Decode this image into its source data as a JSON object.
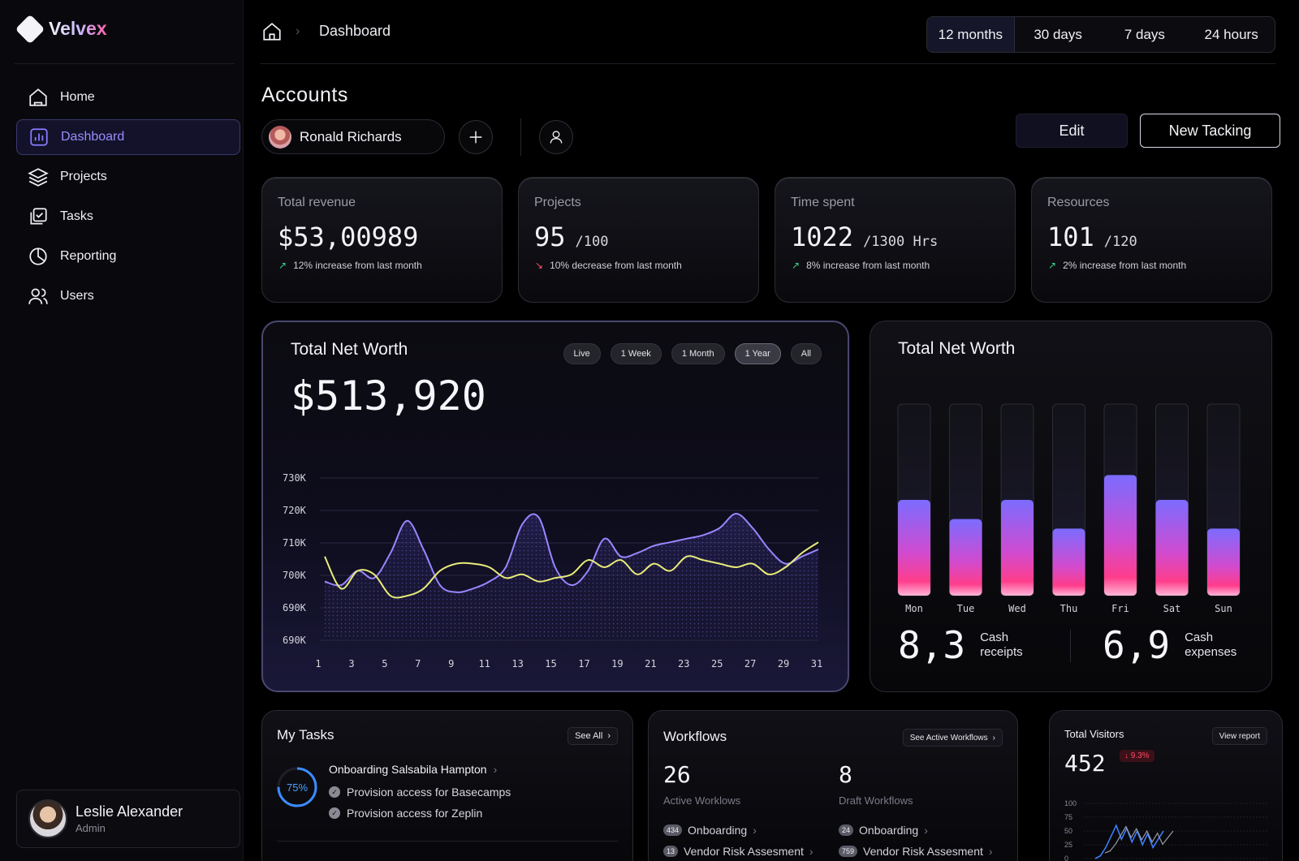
{
  "brand": {
    "name": "Velvex"
  },
  "sidebar": {
    "items": [
      {
        "label": "Home",
        "icon": "home-icon",
        "active": false
      },
      {
        "label": "Dashboard",
        "icon": "chart-icon",
        "active": true
      },
      {
        "label": "Projects",
        "icon": "layers-icon",
        "active": false
      },
      {
        "label": "Tasks",
        "icon": "tasks-icon",
        "active": false
      },
      {
        "label": "Reporting",
        "icon": "pie-icon",
        "active": false
      },
      {
        "label": "Users",
        "icon": "users-icon",
        "active": false
      }
    ],
    "user": {
      "name": "Leslie Alexander",
      "role": "Admin"
    }
  },
  "header": {
    "breadcrumb": "Dashboard",
    "ranges": [
      "12 months",
      "30 days",
      "7 days",
      "24 hours"
    ],
    "active_range": "12 months"
  },
  "accounts": {
    "title": "Accounts",
    "selected_account": "Ronald Richards",
    "edit_label": "Edit",
    "new_label": "New Tacking"
  },
  "stats": [
    {
      "label": "Total revenue",
      "value": "$53,00989",
      "suffix": "",
      "trend": "up",
      "note": "12% increase from last month"
    },
    {
      "label": "Projects",
      "value": "95",
      "suffix": "/100",
      "trend": "down",
      "note": "10% decrease from last month"
    },
    {
      "label": "Time spent",
      "value": "1022",
      "suffix": "/1300 Hrs",
      "trend": "up",
      "note": "8% increase from last month"
    },
    {
      "label": "Resources",
      "value": "101",
      "suffix": "/120",
      "trend": "up",
      "note": "2% increase from last month"
    }
  ],
  "net_worth": {
    "title": "Total Net Worth",
    "value": "$513,920",
    "periods": [
      "Live",
      "1 Week",
      "1 Month",
      "1 Year",
      "All"
    ],
    "active_period": "1 Year"
  },
  "net_worth_bars": {
    "title": "Total Net Worth",
    "receipts": {
      "value": "8,3",
      "label_line1": "Cash",
      "label_line2": "receipts"
    },
    "expenses": {
      "value": "6,9",
      "label_line1": "Cash",
      "label_line2": "expenses"
    }
  },
  "tasks": {
    "title": "My Tasks",
    "see_all": "See All",
    "progress": "75%",
    "group": "Onboarding Salsabila Hampton",
    "items": [
      "Provision access for Basecamps",
      "Provision access for Zeplin"
    ]
  },
  "workflows": {
    "title": "Workflows",
    "see_active": "See Active Workflows",
    "active": {
      "count": "26",
      "label": "Active Worklows"
    },
    "draft": {
      "count": "8",
      "label": "Draft Workflows"
    },
    "active_rows": [
      {
        "badge": "434",
        "label": "Onboarding"
      },
      {
        "badge": "13",
        "label": "Vendor Risk Assesment"
      }
    ],
    "draft_rows": [
      {
        "badge": "24",
        "label": "Onboarding"
      },
      {
        "badge": "759",
        "label": "Vendor Risk Assesment"
      }
    ]
  },
  "visitors": {
    "title": "Total Visitors",
    "view_report": "View report",
    "value": "452",
    "change": "9.3%",
    "y_ticks": [
      "100",
      "75",
      "50",
      "25",
      "0"
    ]
  },
  "colors": {
    "accent": "#8b7dff",
    "line_purple": "#9a86ff",
    "line_yellow": "#e9ec7a",
    "bar_top": "#7b6cff",
    "bar_bottom": "#ff3d8b",
    "up": "#3dd68c",
    "down": "#ff4f6a"
  },
  "chart_data": [
    {
      "type": "line",
      "title": "Total Net Worth",
      "x": [
        1,
        2,
        3,
        4,
        5,
        6,
        7,
        8,
        9,
        10,
        11,
        12,
        13,
        14,
        15,
        16,
        17,
        18,
        19,
        20,
        21,
        22,
        23,
        24,
        25,
        26,
        27,
        28,
        29,
        30,
        31
      ],
      "y_ticks": [
        "730K",
        "720K",
        "710K",
        "700K",
        "690K",
        "690K"
      ],
      "x_ticks": [
        "1",
        "3",
        "5",
        "7",
        "9",
        "11",
        "13",
        "15",
        "17",
        "19",
        "21",
        "23",
        "25",
        "27",
        "29",
        "31"
      ],
      "ylim": [
        685,
        730
      ],
      "series": [
        {
          "values": [
            701,
            700,
            704,
            702,
            709,
            718,
            710,
            700,
            698,
            699,
            701,
            705,
            717,
            719,
            705,
            700,
            704,
            713,
            708,
            709,
            711,
            712,
            713,
            714,
            716,
            720,
            716,
            710,
            706,
            708,
            710
          ]
        },
        {
          "values": [
            708,
            699,
            704,
            703,
            697,
            697,
            699,
            704,
            706,
            706,
            705,
            702,
            703,
            701,
            702,
            703,
            707,
            705,
            707,
            703,
            706,
            704,
            708,
            707,
            706,
            705,
            706,
            703,
            705,
            709,
            712
          ]
        }
      ]
    },
    {
      "type": "bar",
      "title": "Total Net Worth",
      "categories": [
        "Mon",
        "Tue",
        "Wed",
        "Thu",
        "Fri",
        "Sat",
        "Sun"
      ],
      "values": [
        50,
        40,
        50,
        35,
        63,
        50,
        35
      ],
      "ylim": [
        0,
        100
      ]
    },
    {
      "type": "line",
      "title": "Total Visitors",
      "ylim": [
        0,
        100
      ],
      "series": [
        {
          "values": [
            0,
            5,
            20,
            40,
            60,
            35,
            55,
            30,
            50,
            25,
            45,
            20,
            35,
            50
          ]
        }
      ]
    }
  ]
}
